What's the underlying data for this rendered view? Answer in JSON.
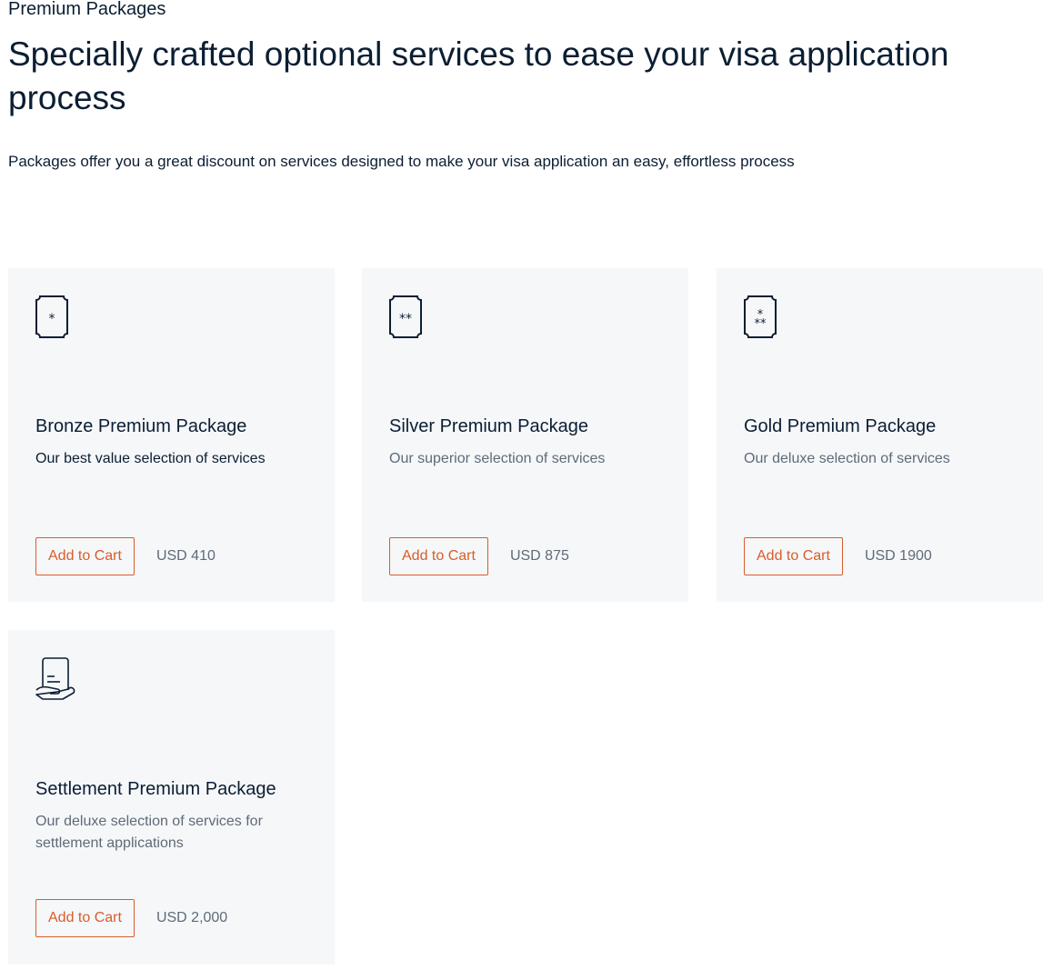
{
  "header": {
    "eyebrow": "Premium Packages",
    "headline": "Specially crafted optional services to ease your visa application process",
    "intro": "Packages offer you a great discount on services designed to make your visa application an easy, effortless process"
  },
  "colors": {
    "accent": "#d85d2a",
    "text": "#0b1e33",
    "muted": "#5f6b78",
    "card_bg": "#f6f7f9"
  },
  "packages": [
    {
      "icon": "one-star-badge-icon",
      "title": "Bronze Premium Package",
      "description": "Our best value selection of services",
      "button": "Add to Cart",
      "price": "USD 410"
    },
    {
      "icon": "two-star-badge-icon",
      "title": "Silver Premium Package",
      "description": "Our superior selection of services",
      "button": "Add to Cart",
      "price": "USD 875"
    },
    {
      "icon": "three-star-badge-icon",
      "title": "Gold Premium Package",
      "description": "Our deluxe selection of services",
      "button": "Add to Cart",
      "price": "USD 1900"
    },
    {
      "icon": "document-in-hand-icon",
      "title": "Settlement Premium Package",
      "description": "Our deluxe selection of services for settlement applications",
      "button": "Add to Cart",
      "price": "USD 2,000"
    }
  ]
}
